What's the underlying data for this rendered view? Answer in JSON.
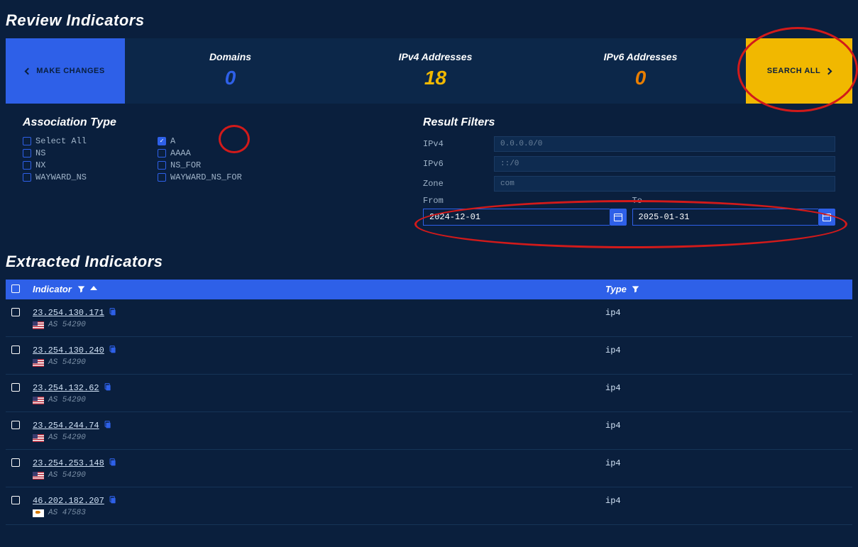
{
  "title_review": "Review Indicators",
  "make_changes_label": "MAKE CHANGES",
  "search_all_label": "SEARCH ALL",
  "stats": {
    "domains_label": "Domains",
    "domains_value": "0",
    "ipv4_label": "IPv4 Addresses",
    "ipv4_value": "18",
    "ipv6_label": "IPv6 Addresses",
    "ipv6_value": "0"
  },
  "assoc": {
    "heading": "Association Type",
    "left": {
      "select_all": "Select All",
      "ns": "NS",
      "nx": "NX",
      "wayward_ns": "WAYWARD_NS"
    },
    "right": {
      "a": "A",
      "aaaa": "AAAA",
      "ns_for": "NS_FOR",
      "wayward_ns_for": "WAYWARD_NS_FOR"
    }
  },
  "filters": {
    "heading": "Result Filters",
    "ipv4_label": "IPv4",
    "ipv4_placeholder": "0.0.0.0/0",
    "ipv6_label": "IPv6",
    "ipv6_placeholder": "::/0",
    "zone_label": "Zone",
    "zone_placeholder": "com",
    "from_label": "From",
    "from_value": "2024-12-01",
    "to_label": "To",
    "to_value": "2025-01-31"
  },
  "title_extracted": "Extracted Indicators",
  "table": {
    "col_indicator": "Indicator",
    "col_type": "Type"
  },
  "rows": [
    {
      "ip": "23.254.130.171",
      "asn": "AS 54290",
      "flag": "us",
      "type": "ip4"
    },
    {
      "ip": "23.254.130.240",
      "asn": "AS 54290",
      "flag": "us",
      "type": "ip4"
    },
    {
      "ip": "23.254.132.62",
      "asn": "AS 54290",
      "flag": "us",
      "type": "ip4"
    },
    {
      "ip": "23.254.244.74",
      "asn": "AS 54290",
      "flag": "us",
      "type": "ip4"
    },
    {
      "ip": "23.254.253.148",
      "asn": "AS 54290",
      "flag": "us",
      "type": "ip4"
    },
    {
      "ip": "46.202.182.207",
      "asn": "AS 47583",
      "flag": "cy",
      "type": "ip4"
    }
  ]
}
